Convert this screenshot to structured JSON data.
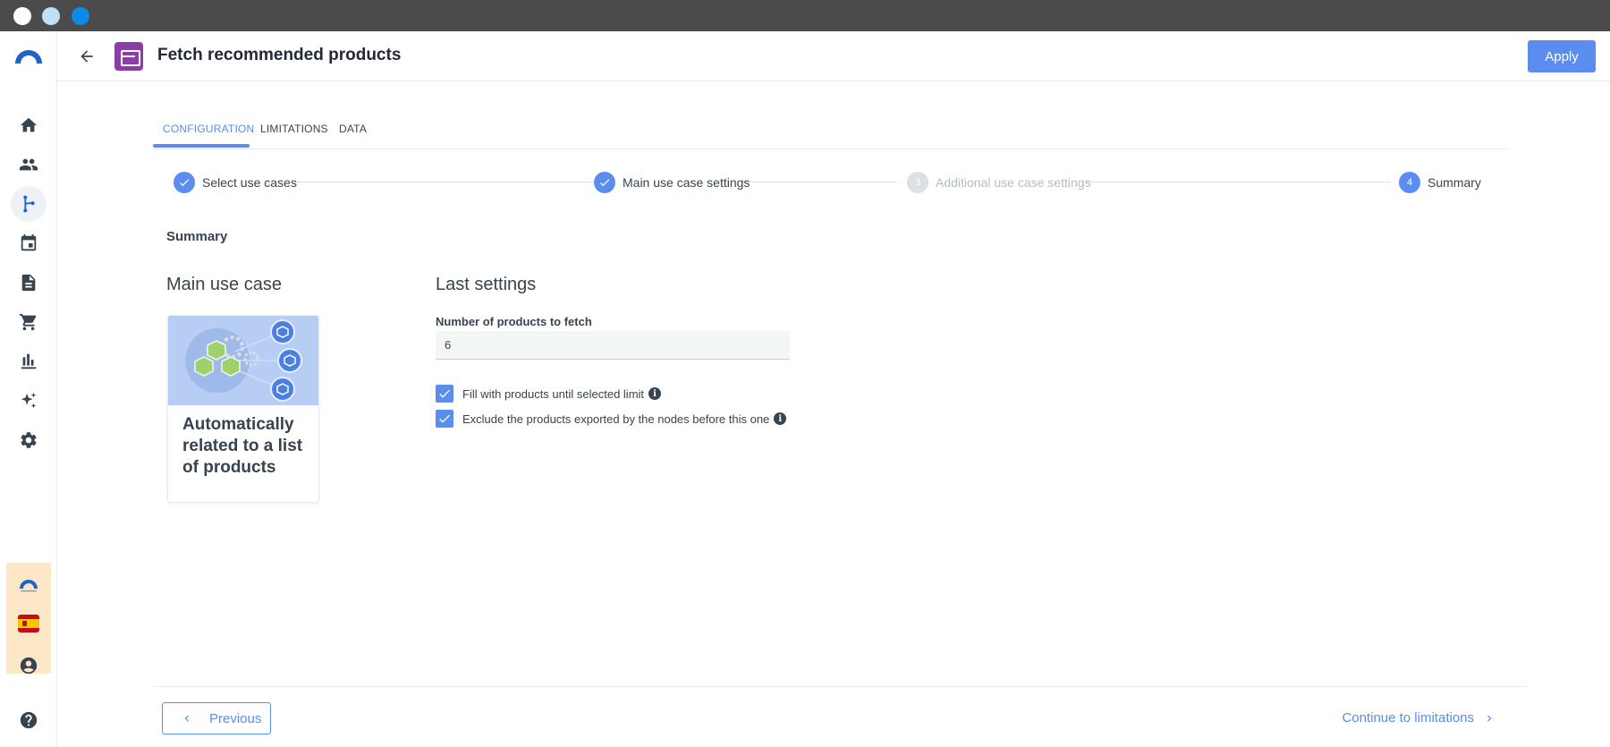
{
  "window": {
    "controls": [
      "close",
      "minimize",
      "maximize"
    ]
  },
  "sidebar": {
    "items": [
      {
        "icon": "home-icon"
      },
      {
        "icon": "people-icon"
      },
      {
        "icon": "workflow-icon",
        "active": true
      },
      {
        "icon": "calendar-icon"
      },
      {
        "icon": "document-icon"
      },
      {
        "icon": "cart-icon"
      },
      {
        "icon": "bar-chart-icon"
      },
      {
        "icon": "sparkle-icon"
      },
      {
        "icon": "gear-icon"
      }
    ],
    "bottom": [
      "brand-logo",
      "spain-flag-icon",
      "account-icon",
      "help-icon"
    ]
  },
  "header": {
    "title": "Fetch recommended products",
    "apply_label": "Apply"
  },
  "tabs": [
    {
      "label": "CONFIGURATION",
      "active": true
    },
    {
      "label": "LIMITATIONS",
      "active": false
    },
    {
      "label": "DATA",
      "active": false
    }
  ],
  "stepper": [
    {
      "label": "Select use cases",
      "state": "done"
    },
    {
      "label": "Main use case settings",
      "state": "done"
    },
    {
      "number": "3",
      "label": "Additional use case settings",
      "state": "todo"
    },
    {
      "number": "4",
      "label": "Summary",
      "state": "current"
    }
  ],
  "summary": {
    "title": "Summary",
    "main_use_case": {
      "heading": "Main use case",
      "card_text": "Automatically related to a list of products"
    },
    "last_settings": {
      "heading": "Last settings",
      "products_label": "Number of products to fetch",
      "products_value": "6",
      "checkboxes": [
        {
          "label": "Fill with products until selected limit",
          "checked": true
        },
        {
          "label": "Exclude the products exported by the nodes before this one",
          "checked": true
        }
      ]
    }
  },
  "footer": {
    "previous_label": "Previous",
    "continue_label": "Continue to limitations"
  },
  "colors": {
    "accent": "#5b8def",
    "node_icon": "#8b3ea8",
    "titlebar": "#4b4b4b",
    "brand_box": "#fde7c6"
  }
}
